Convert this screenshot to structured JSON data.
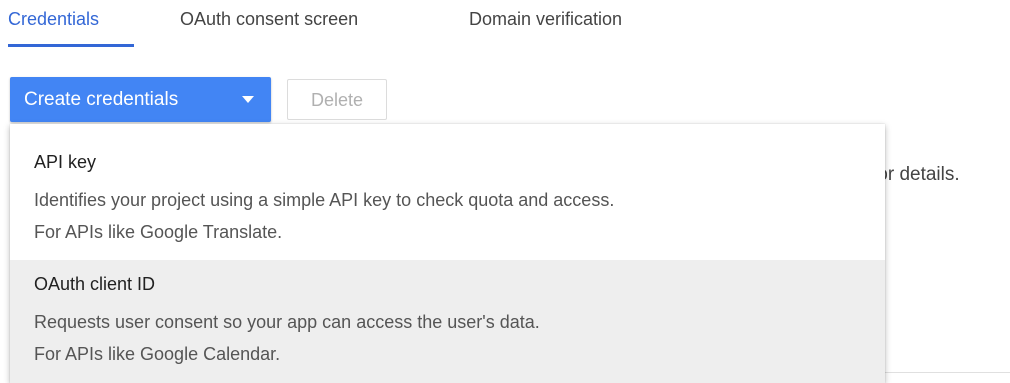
{
  "tabs": [
    {
      "label": "Credentials",
      "active": true
    },
    {
      "label": "OAuth consent screen",
      "active": false
    },
    {
      "label": "Domain verification",
      "active": false
    }
  ],
  "toolbar": {
    "create_label": "Create credentials",
    "caret_icon": "caret-down-icon",
    "delete_label": "Delete"
  },
  "background": {
    "details_text": "for details."
  },
  "menu": {
    "items": [
      {
        "title": "API key",
        "desc_line1": "Identifies your project using a simple API key to check quota and access.",
        "desc_line2": "For APIs like Google Translate."
      },
      {
        "title": "OAuth client ID",
        "desc_line1": "Requests user consent so your app can access the user's data.",
        "desc_line2": "For APIs like Google Calendar."
      }
    ]
  },
  "colors": {
    "accent": "#3367d6",
    "primary_button": "#4285f4",
    "hover_row": "#eeeeee"
  }
}
